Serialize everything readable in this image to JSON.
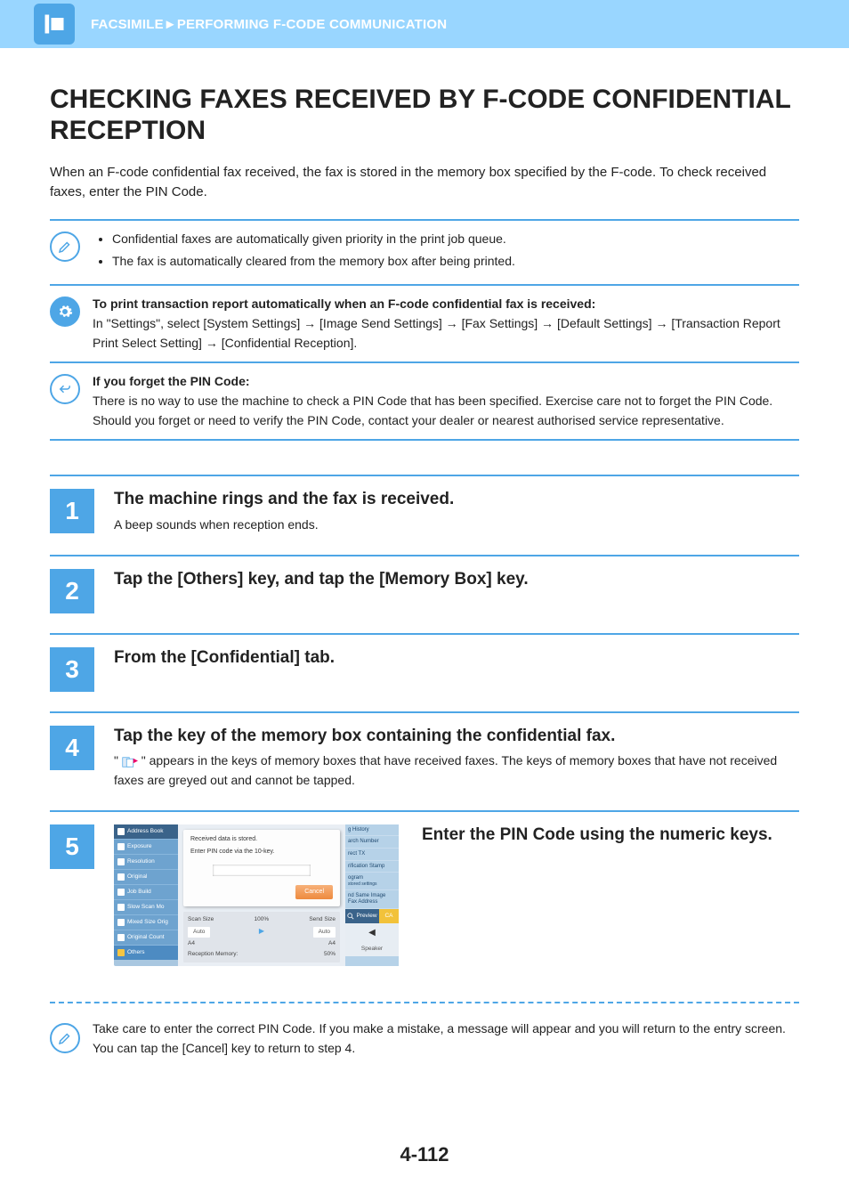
{
  "breadcrumb": "FACSIMILE►PERFORMING F-CODE COMMUNICATION",
  "page_title": "CHECKING FAXES RECEIVED BY F-CODE CONFIDENTIAL RECEPTION",
  "intro": "When an F-code confidential fax received, the fax is stored in the memory box specified by the F-code. To check received faxes, enter the PIN Code.",
  "notes": {
    "n1_bullet1": "Confidential faxes are automatically given priority in the print job queue.",
    "n1_bullet2": "The fax is automatically cleared from the memory box after being printed.",
    "n2_bold": "To print transaction report automatically when an F-code confidential fax is received:",
    "n2_text": "In \"Settings\", select [System Settings] → [Image Send Settings] → [Fax Settings] → [Default Settings] → [Transaction Report Print Select Setting] → [Confidential Reception].",
    "n3_bold": "If you forget the PIN Code:",
    "n3_text": "There is no way to use the machine to check a PIN Code that has been specified. Exercise care not to forget the PIN Code. Should you forget or need to verify the PIN Code, contact your dealer or nearest authorised service representative."
  },
  "steps": {
    "s1": {
      "num": "1",
      "title": "The machine rings and the fax is received.",
      "text": "A beep sounds when reception ends."
    },
    "s2": {
      "num": "2",
      "title": "Tap the [Others] key, and tap the [Memory Box] key."
    },
    "s3": {
      "num": "3",
      "title": "From the [Confidential] tab."
    },
    "s4": {
      "num": "4",
      "title": "Tap the key of the memory box containing the confidential fax.",
      "text_before": "\" ",
      "text_after": " \" appears in the keys of memory boxes that have received faxes. The keys of memory boxes that have not received faxes are greyed out and cannot be tapped."
    },
    "s5": {
      "num": "5",
      "title": "Enter the PIN Code using the numeric keys."
    }
  },
  "screenshot": {
    "left": {
      "address_book": "Address Book",
      "exposure": "Exposure",
      "resolution": "Resolution",
      "original": "Original",
      "job_build": "Job Build",
      "slow_scan": "Slow Scan Mo",
      "mixed_size": "Mixed Size Orig",
      "original_count": "Original Count",
      "others": "Others"
    },
    "dialog": {
      "msg1": "Received data is stored.",
      "msg2": "Enter PIN code via the 10-key.",
      "cancel": "Cancel"
    },
    "scanbar": {
      "scan_size": "Scan Size",
      "send_size": "Send Size",
      "auto1": "Auto",
      "auto2": "Auto",
      "a4_1": "A4",
      "a4_2": "A4",
      "ratio": "100%",
      "recmem_label": "Reception Memory:",
      "recmem_val": "50%"
    },
    "right": {
      "history": "g History",
      "search_num": "arch Number",
      "rect_tx": "rect TX",
      "verif_stamp": "rification Stamp",
      "ogram": "ogram",
      "stored_settings": "stored settings",
      "send_same": "nd Same Image",
      "fax_addr": "Fax Address",
      "preview": "Preview",
      "ca": "CA",
      "speaker": "Speaker"
    }
  },
  "tail_note": "Take care to enter the correct PIN Code. If you make a mistake, a message will appear and you will return to the entry screen. You can tap the [Cancel] key to return to step 4.",
  "page_number": "4-112"
}
